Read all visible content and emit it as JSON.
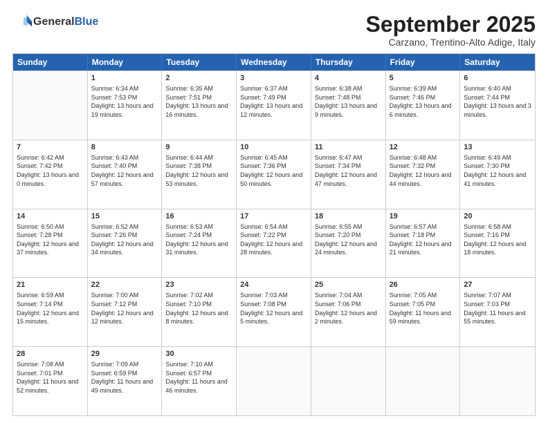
{
  "logo": {
    "general": "General",
    "blue": "Blue"
  },
  "title": "September 2025",
  "subtitle": "Carzano, Trentino-Alto Adige, Italy",
  "header_days": [
    "Sunday",
    "Monday",
    "Tuesday",
    "Wednesday",
    "Thursday",
    "Friday",
    "Saturday"
  ],
  "rows": [
    [
      {
        "day": "",
        "sunrise": "",
        "sunset": "",
        "daylight": ""
      },
      {
        "day": "1",
        "sunrise": "Sunrise: 6:34 AM",
        "sunset": "Sunset: 7:53 PM",
        "daylight": "Daylight: 13 hours and 19 minutes."
      },
      {
        "day": "2",
        "sunrise": "Sunrise: 6:35 AM",
        "sunset": "Sunset: 7:51 PM",
        "daylight": "Daylight: 13 hours and 16 minutes."
      },
      {
        "day": "3",
        "sunrise": "Sunrise: 6:37 AM",
        "sunset": "Sunset: 7:49 PM",
        "daylight": "Daylight: 13 hours and 12 minutes."
      },
      {
        "day": "4",
        "sunrise": "Sunrise: 6:38 AM",
        "sunset": "Sunset: 7:48 PM",
        "daylight": "Daylight: 13 hours and 9 minutes."
      },
      {
        "day": "5",
        "sunrise": "Sunrise: 6:39 AM",
        "sunset": "Sunset: 7:46 PM",
        "daylight": "Daylight: 13 hours and 6 minutes."
      },
      {
        "day": "6",
        "sunrise": "Sunrise: 6:40 AM",
        "sunset": "Sunset: 7:44 PM",
        "daylight": "Daylight: 13 hours and 3 minutes."
      }
    ],
    [
      {
        "day": "7",
        "sunrise": "Sunrise: 6:42 AM",
        "sunset": "Sunset: 7:42 PM",
        "daylight": "Daylight: 13 hours and 0 minutes."
      },
      {
        "day": "8",
        "sunrise": "Sunrise: 6:43 AM",
        "sunset": "Sunset: 7:40 PM",
        "daylight": "Daylight: 12 hours and 57 minutes."
      },
      {
        "day": "9",
        "sunrise": "Sunrise: 6:44 AM",
        "sunset": "Sunset: 7:38 PM",
        "daylight": "Daylight: 12 hours and 53 minutes."
      },
      {
        "day": "10",
        "sunrise": "Sunrise: 6:45 AM",
        "sunset": "Sunset: 7:36 PM",
        "daylight": "Daylight: 12 hours and 50 minutes."
      },
      {
        "day": "11",
        "sunrise": "Sunrise: 6:47 AM",
        "sunset": "Sunset: 7:34 PM",
        "daylight": "Daylight: 12 hours and 47 minutes."
      },
      {
        "day": "12",
        "sunrise": "Sunrise: 6:48 AM",
        "sunset": "Sunset: 7:32 PM",
        "daylight": "Daylight: 12 hours and 44 minutes."
      },
      {
        "day": "13",
        "sunrise": "Sunrise: 6:49 AM",
        "sunset": "Sunset: 7:30 PM",
        "daylight": "Daylight: 12 hours and 41 minutes."
      }
    ],
    [
      {
        "day": "14",
        "sunrise": "Sunrise: 6:50 AM",
        "sunset": "Sunset: 7:28 PM",
        "daylight": "Daylight: 12 hours and 37 minutes."
      },
      {
        "day": "15",
        "sunrise": "Sunrise: 6:52 AM",
        "sunset": "Sunset: 7:26 PM",
        "daylight": "Daylight: 12 hours and 34 minutes."
      },
      {
        "day": "16",
        "sunrise": "Sunrise: 6:53 AM",
        "sunset": "Sunset: 7:24 PM",
        "daylight": "Daylight: 12 hours and 31 minutes."
      },
      {
        "day": "17",
        "sunrise": "Sunrise: 6:54 AM",
        "sunset": "Sunset: 7:22 PM",
        "daylight": "Daylight: 12 hours and 28 minutes."
      },
      {
        "day": "18",
        "sunrise": "Sunrise: 6:55 AM",
        "sunset": "Sunset: 7:20 PM",
        "daylight": "Daylight: 12 hours and 24 minutes."
      },
      {
        "day": "19",
        "sunrise": "Sunrise: 6:57 AM",
        "sunset": "Sunset: 7:18 PM",
        "daylight": "Daylight: 12 hours and 21 minutes."
      },
      {
        "day": "20",
        "sunrise": "Sunrise: 6:58 AM",
        "sunset": "Sunset: 7:16 PM",
        "daylight": "Daylight: 12 hours and 18 minutes."
      }
    ],
    [
      {
        "day": "21",
        "sunrise": "Sunrise: 6:59 AM",
        "sunset": "Sunset: 7:14 PM",
        "daylight": "Daylight: 12 hours and 15 minutes."
      },
      {
        "day": "22",
        "sunrise": "Sunrise: 7:00 AM",
        "sunset": "Sunset: 7:12 PM",
        "daylight": "Daylight: 12 hours and 12 minutes."
      },
      {
        "day": "23",
        "sunrise": "Sunrise: 7:02 AM",
        "sunset": "Sunset: 7:10 PM",
        "daylight": "Daylight: 12 hours and 8 minutes."
      },
      {
        "day": "24",
        "sunrise": "Sunrise: 7:03 AM",
        "sunset": "Sunset: 7:08 PM",
        "daylight": "Daylight: 12 hours and 5 minutes."
      },
      {
        "day": "25",
        "sunrise": "Sunrise: 7:04 AM",
        "sunset": "Sunset: 7:06 PM",
        "daylight": "Daylight: 12 hours and 2 minutes."
      },
      {
        "day": "26",
        "sunrise": "Sunrise: 7:05 AM",
        "sunset": "Sunset: 7:05 PM",
        "daylight": "Daylight: 11 hours and 59 minutes."
      },
      {
        "day": "27",
        "sunrise": "Sunrise: 7:07 AM",
        "sunset": "Sunset: 7:03 PM",
        "daylight": "Daylight: 11 hours and 55 minutes."
      }
    ],
    [
      {
        "day": "28",
        "sunrise": "Sunrise: 7:08 AM",
        "sunset": "Sunset: 7:01 PM",
        "daylight": "Daylight: 11 hours and 52 minutes."
      },
      {
        "day": "29",
        "sunrise": "Sunrise: 7:09 AM",
        "sunset": "Sunset: 6:59 PM",
        "daylight": "Daylight: 11 hours and 49 minutes."
      },
      {
        "day": "30",
        "sunrise": "Sunrise: 7:10 AM",
        "sunset": "Sunset: 6:57 PM",
        "daylight": "Daylight: 11 hours and 46 minutes."
      },
      {
        "day": "",
        "sunrise": "",
        "sunset": "",
        "daylight": ""
      },
      {
        "day": "",
        "sunrise": "",
        "sunset": "",
        "daylight": ""
      },
      {
        "day": "",
        "sunrise": "",
        "sunset": "",
        "daylight": ""
      },
      {
        "day": "",
        "sunrise": "",
        "sunset": "",
        "daylight": ""
      }
    ]
  ]
}
